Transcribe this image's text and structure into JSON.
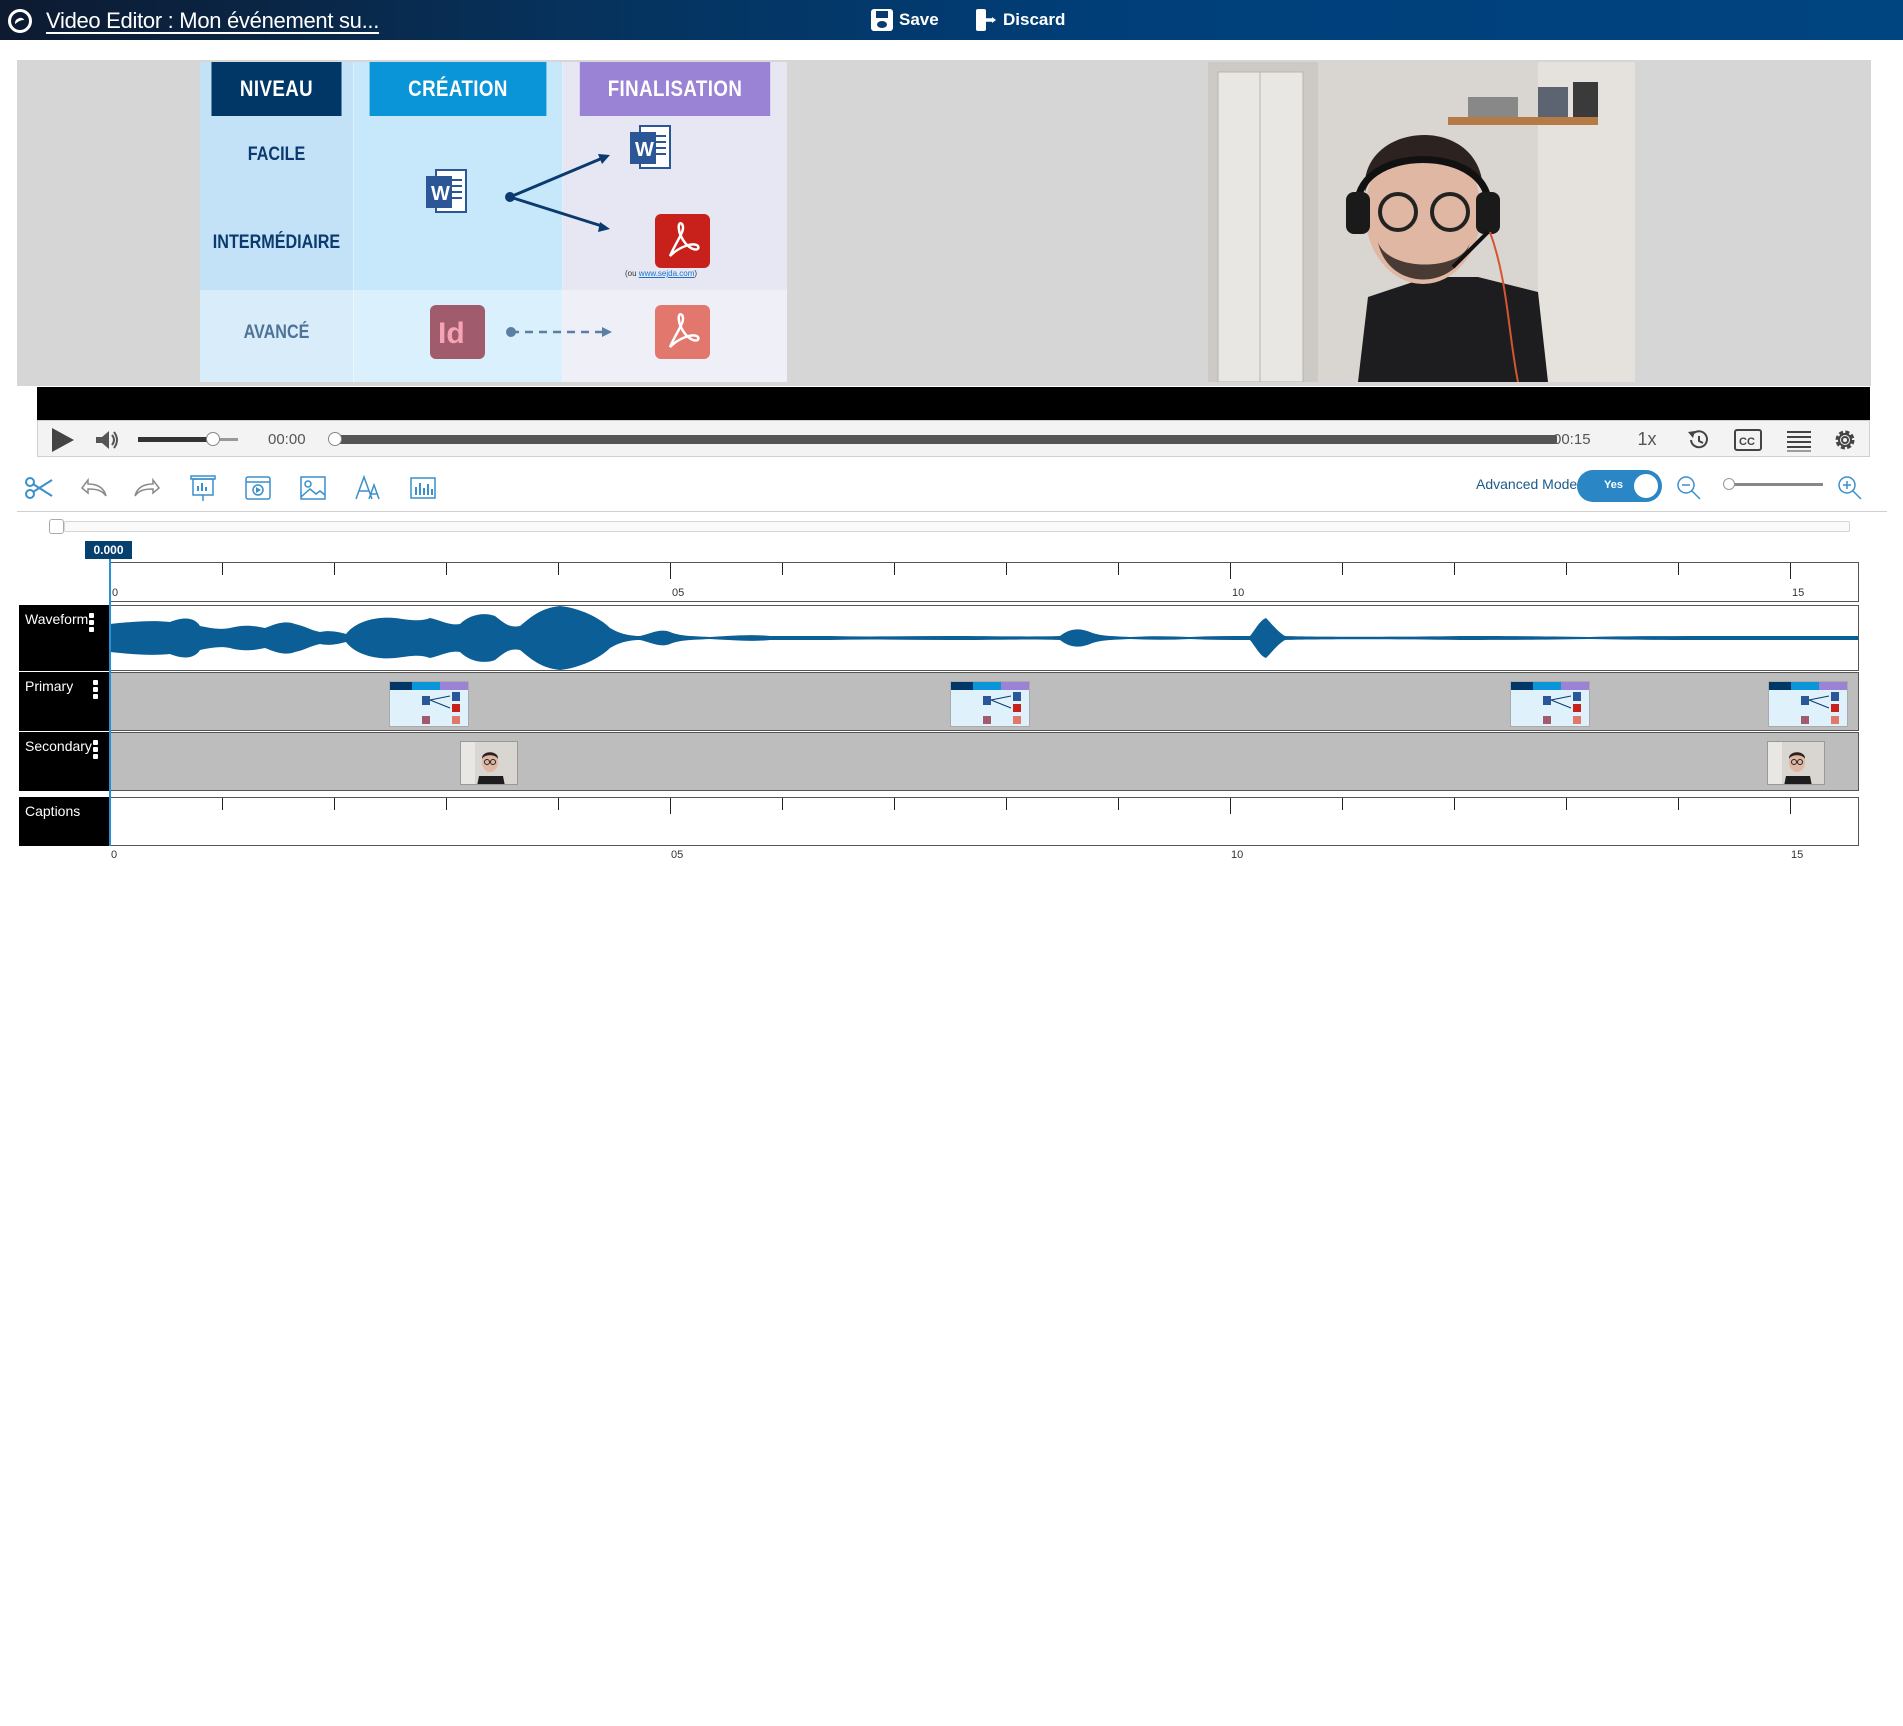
{
  "header": {
    "title": "Video Editor : Mon événement su...",
    "save_label": "Save",
    "discard_label": "Discard"
  },
  "slide": {
    "col_headers": [
      "NIVEAU",
      "CRÉATION",
      "FINALISATION"
    ],
    "levels": [
      "FACILE",
      "INTERMÉDIAIRE",
      "AVANCÉ"
    ],
    "note_prefix": "(ou ",
    "note_link": "www.sejda.com",
    "note_suffix": ")",
    "word_letter": "W",
    "indesign_letters": "Id"
  },
  "player": {
    "current_time": "00:00",
    "duration": "00:15",
    "speed": "1x",
    "volume": 0.75,
    "progress": 0.0,
    "cc_label": "CC"
  },
  "toolbar": {
    "advanced_mode_label": "Advanced Mode",
    "toggle_value": "Yes"
  },
  "timeline": {
    "playhead_time": "0.000",
    "ruler_labels": [
      "0",
      "05",
      "10",
      "15"
    ],
    "tracks": {
      "waveform": "Waveform",
      "primary": "Primary",
      "secondary": "Secondary",
      "captions": "Captions"
    }
  },
  "colors": {
    "header_blue": "#003f7a",
    "accent_blue": "#2b86c5",
    "waveform": "#0b5e96",
    "track_gray": "#bdbdbd"
  }
}
